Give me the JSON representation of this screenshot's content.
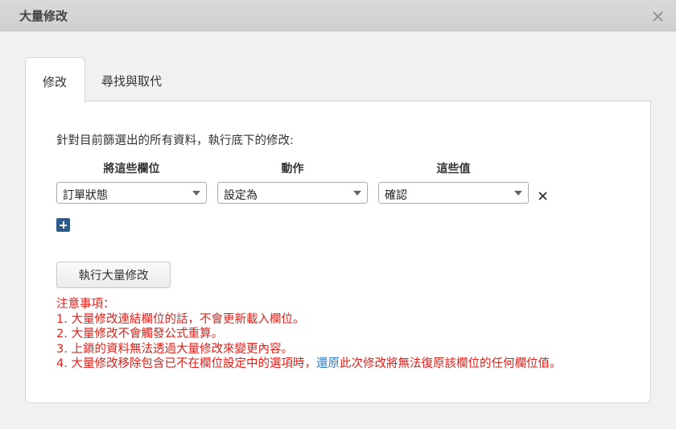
{
  "dialog": {
    "title": "大量修改"
  },
  "tabs": [
    {
      "label": "修改",
      "active": true
    },
    {
      "label": "尋找與取代",
      "active": false
    }
  ],
  "main": {
    "description": "針對目前篩選出的所有資料，執行底下的修改:",
    "columns": [
      "將這些欄位",
      "動作",
      "這些值"
    ],
    "row": {
      "field": "訂單狀態",
      "action": "設定為",
      "value": "確認"
    },
    "run_button": "執行大量修改"
  },
  "notes": {
    "heading": "注意事項：",
    "items": [
      "1. 大量修改連結欄位的話，不會更新載入欄位。",
      "2. 大量修改不會觸發公式重算。",
      "3. 上鎖的資料無法透過大量修改來變更內容。"
    ],
    "item4_prefix": "4. 大量修改移除包含已不在欄位設定中的選項時，",
    "item4_link": "還原",
    "item4_suffix": "此次修改將無法復原該欄位的任何欄位值。"
  },
  "colors": {
    "accent": "#2d5b8c",
    "warning": "#e0201b",
    "link": "#2c7bbf"
  },
  "icons": {
    "close": "close-icon",
    "remove": "remove-icon",
    "add": "plus-icon",
    "dropdown": "chevron-down-icon"
  }
}
